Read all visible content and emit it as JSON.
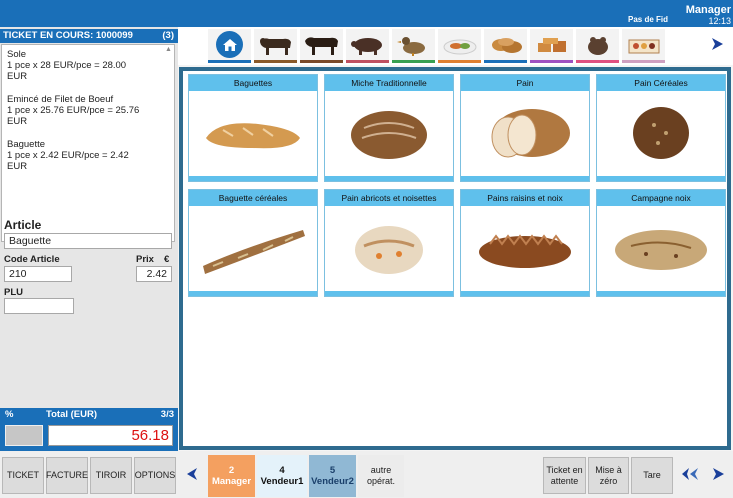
{
  "header": {
    "user": "Manager",
    "clock": "12:13",
    "fid": "Pas de Fid"
  },
  "ticket": {
    "title": "TICKET EN COURS: 1000099",
    "count": "(3)",
    "lines": [
      {
        "name": "Sole",
        "detail": "1 pce x 28 EUR/pce = 28.00",
        "unit": "EUR"
      },
      {
        "name": "Emincé de Filet de Boeuf",
        "detail": "1 pce x 25.76 EUR/pce = 25.76",
        "unit": "EUR"
      },
      {
        "name": "Baguette",
        "detail": "1 pce x 2.42 EUR/pce = 2.42",
        "unit": "EUR"
      }
    ]
  },
  "article": {
    "label": "Article",
    "value": "Baguette",
    "code_label": "Code Article",
    "code": "210",
    "prix_label": "Prix",
    "currency": "€",
    "prix": "2.42",
    "plu_label": "PLU",
    "plu": ""
  },
  "total": {
    "pct": "%",
    "label": "Total (EUR)",
    "pages": "3/3",
    "value": "56.18"
  },
  "categories": [
    "home-icon",
    "cow-icon",
    "bull-icon",
    "pig-icon",
    "duck-icon",
    "prepared-dish-icon",
    "bread-icon",
    "pastry-icon",
    "cheese-icon",
    "gift-box-icon"
  ],
  "products": [
    "Baguettes",
    "Miche Traditionnelle",
    "Pain",
    "Pain Céréales",
    "Baguette céréales",
    "Pain abricots et noisettes",
    "Pains raisins et noix",
    "Campagne noix"
  ],
  "bottom": {
    "left_buttons": [
      "TICKET",
      "FACTURE",
      "TIROIR",
      "OPTIONS"
    ],
    "vendors": [
      {
        "num": "2",
        "name": "Manager"
      },
      {
        "num": "4",
        "name": "Vendeur1"
      },
      {
        "num": "5",
        "name": "Vendeur2"
      }
    ],
    "autre": [
      "autre",
      "opérat."
    ],
    "right_buttons": [
      [
        "Ticket en",
        "attente"
      ],
      [
        "Mise à",
        "zéro"
      ],
      [
        "Tare"
      ]
    ]
  }
}
